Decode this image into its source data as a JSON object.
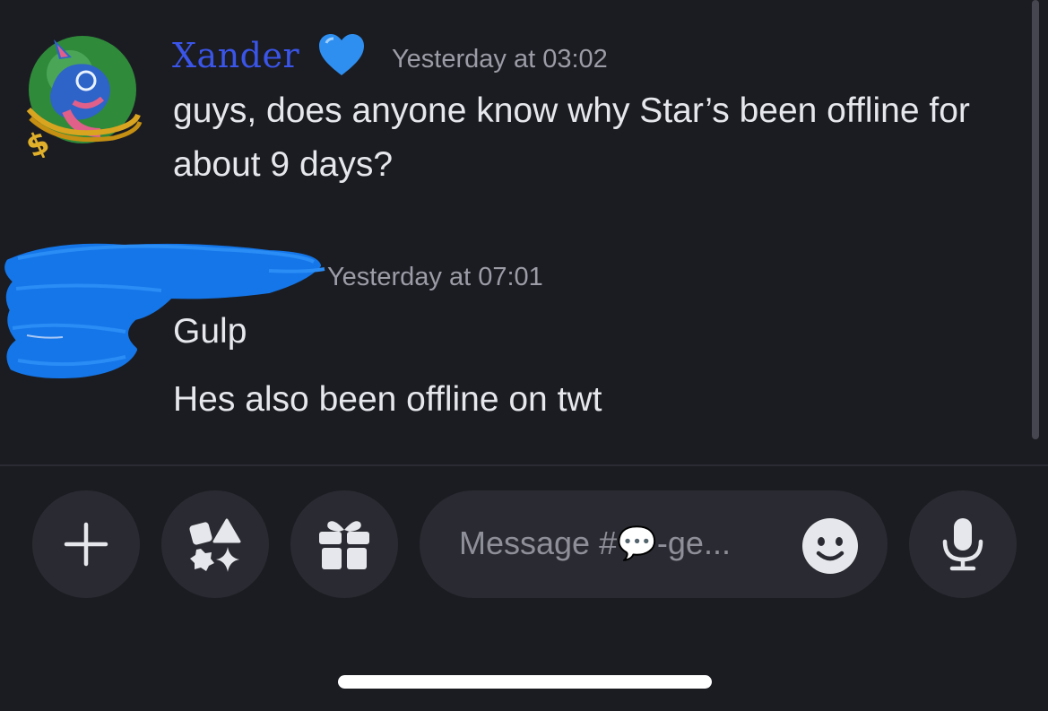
{
  "messages": [
    {
      "author": "Xander",
      "author_badge": "blue-heart-emoji",
      "timestamp": "Yesterday at 03:02",
      "lines": [
        "guys, does anyone know why Star’s been offline for about 9 days?"
      ]
    },
    {
      "author": "",
      "author_redacted": true,
      "timestamp": "Yesterday at 07:01",
      "lines": [
        "Gulp",
        "Hes also been offline on twt"
      ]
    }
  ],
  "composer": {
    "placeholder": "Message #💬-ge...",
    "buttons": {
      "add": "plus-icon",
      "apps": "apps-icon",
      "gift": "gift-icon",
      "emoji": "emoji-icon",
      "voice": "microphone-icon"
    }
  },
  "colors": {
    "background": "#1b1c22",
    "username": "#3a55e8",
    "timestamp": "#9b9ca5",
    "message_text": "#e6e7ec",
    "button_bg": "#2a2b32",
    "scribble": "#1476e8"
  }
}
